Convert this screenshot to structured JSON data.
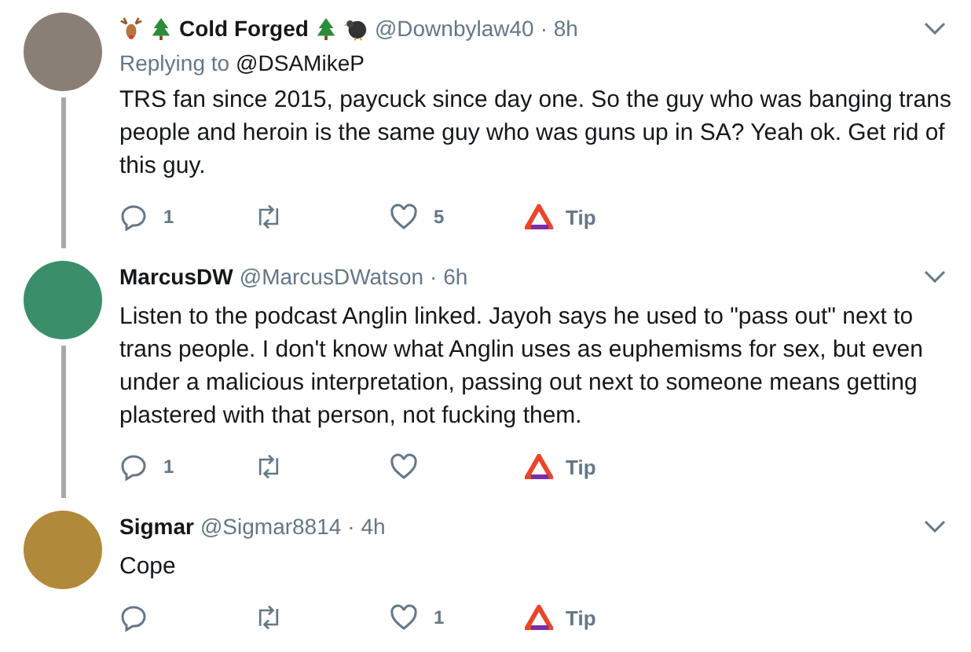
{
  "tweets": [
    {
      "kind": "emoji_name",
      "name": "Cold Forged",
      "handle": "@Downbylaw40",
      "time": "· 8h",
      "replying_label": "Replying to",
      "replying_to": "@DSAMikeP",
      "text": "TRS fan since 2015, paycuck since day one. So the guy who was banging trans people and heroin is the same guy who was guns up in SA? Yeah ok. Get rid of this guy.",
      "thread_line": true,
      "actions": {
        "reply_count": "1",
        "like_count": "5",
        "tip_label": "Tip"
      }
    },
    {
      "kind": "plain",
      "name": "MarcusDW",
      "handle": "@MarcusDWatson",
      "time": "· 6h",
      "text": "Listen to the podcast Anglin linked. Jayoh says he used to \"pass out\" next to trans people. I don't know what Anglin uses as euphemisms for sex, but even under a malicious interpretation, passing out next to someone means getting plastered with that person, not fucking them.",
      "thread_line": true,
      "actions": {
        "reply_count": "1",
        "tip_label": "Tip"
      }
    },
    {
      "kind": "plain",
      "name": "Sigmar",
      "handle": "@Sigmar8814",
      "time": "· 4h",
      "text": "Cope",
      "thread_line": false,
      "actions": {
        "like_count": "1",
        "tip_label": "Tip"
      }
    }
  ]
}
